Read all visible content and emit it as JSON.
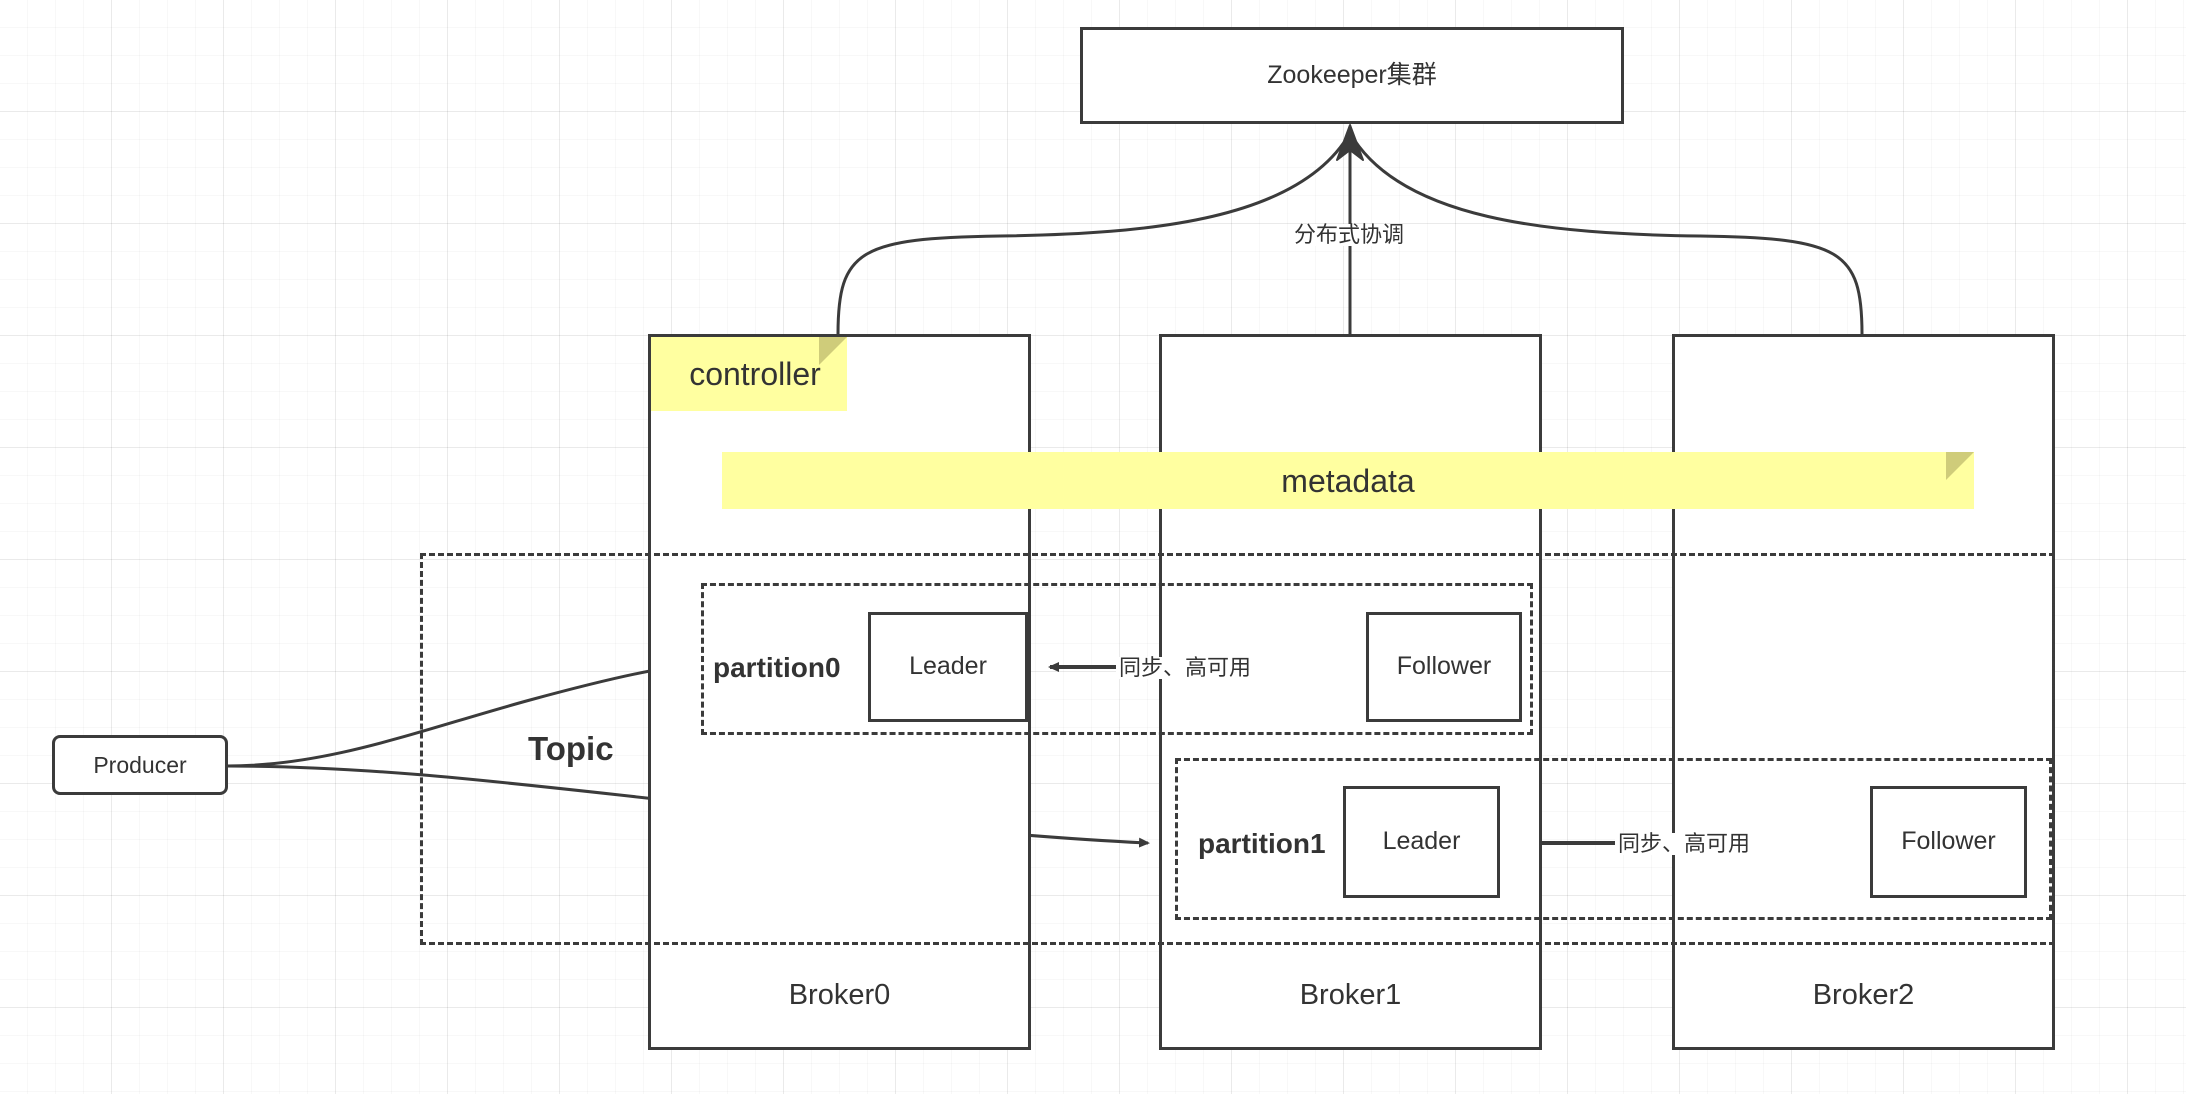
{
  "diagram": {
    "title_nodes": {
      "zookeeper": "Zookeeper集群",
      "topic": "Topic",
      "controller": "controller",
      "metadata": "metadata",
      "producer": "Producer"
    },
    "brokers": [
      {
        "label": "Broker0"
      },
      {
        "label": "Broker1"
      },
      {
        "label": "Broker2"
      }
    ],
    "partitions": [
      {
        "label": "partition0",
        "leader": "Leader",
        "follower": "Follower",
        "replication_label": "同步、高可用"
      },
      {
        "label": "partition1",
        "leader": "Leader",
        "follower": "Follower",
        "replication_label": "同步、高可用"
      }
    ],
    "edges": {
      "coordination_label": "分布式协调"
    },
    "colors": {
      "stroke": "#3b3b3b",
      "note_fill": "#ffffa0",
      "note_fold": "#cfcc7a",
      "text": "#333333",
      "canvas": "#ffffff",
      "grid_minor": "#f2f2f2",
      "grid_major": "#e8e8e8"
    }
  }
}
